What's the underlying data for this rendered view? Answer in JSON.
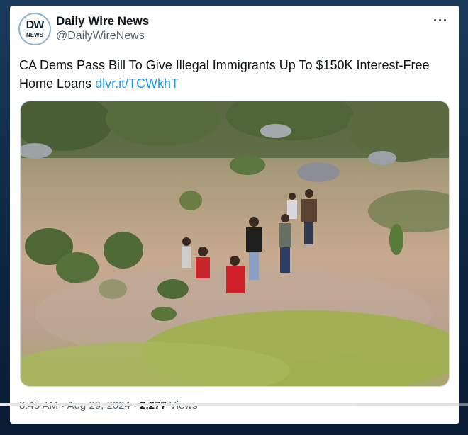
{
  "tweet": {
    "author_name": "Daily Wire News",
    "author_handle": "@DailyWireNews",
    "avatar_text_top": "DW",
    "avatar_text_bottom": "NEWS",
    "more_icon": "more-horizontal-icon",
    "text": "CA Dems Pass Bill To Give Illegal Immigrants Up To $150K Interest-Free Home Loans ",
    "link": "dlvr.it/TCWkhT",
    "time": "8:45 AM",
    "date": "Aug 29, 2024",
    "views_count": "2,277",
    "views_label": "Views"
  },
  "video": {
    "progress": 0.76
  },
  "colors": {
    "link": "#1d9bf0",
    "text": "#0f1419",
    "secondary": "#536471"
  }
}
